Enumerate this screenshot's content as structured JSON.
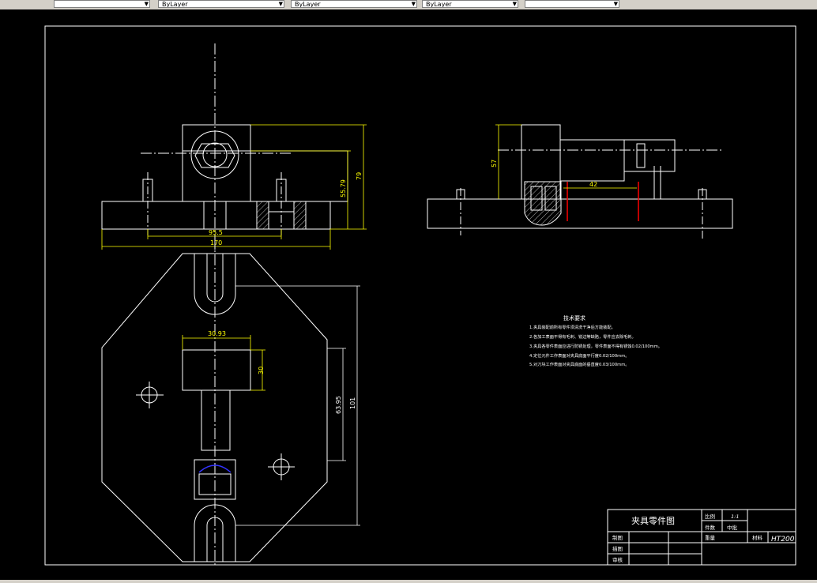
{
  "toolbar": {
    "layer_value": "",
    "color_value": "ByLayer",
    "linetype_value": "ByLayer",
    "lineweight_value": "ByLayer",
    "plotstyle_value": ""
  },
  "dims": {
    "d170": "170",
    "d95_5": "95.5",
    "d79": "79",
    "d55_79": "55.79",
    "d57": "57",
    "d42": "42",
    "d30_93": "30.93",
    "d30": "30",
    "d63_95": "63.95",
    "d101": "101"
  },
  "tech": {
    "title": "技术要求",
    "lines": [
      "1.夹具装配前所有零件须清洗干净后方能装配。",
      "2.各加工表面不得有毛刺、锐边等缺陷，零件应去除毛刺。",
      "3.夹具各零件表面应进行防锈处理，零件表面不得有锈蚀0.02/100mm。",
      "4.定位元件工作表面对夹具底面平行度0.02/100mm。",
      "5.对刀块工作表面对夹具底面的垂直度0.03/100mm。"
    ]
  },
  "title_block": {
    "name": "夹具零件图",
    "scale_label": "比例",
    "scale_value": "1:1",
    "count_label": "件数",
    "count_value": "中批",
    "weight_label": "重量",
    "material_label": "材料",
    "material_value": "HT200",
    "drawn_label": "制图",
    "designed_label": "描图",
    "checked_label": "审核"
  },
  "colors": {
    "lines": "#ffffff",
    "dimension": "#ffff00",
    "accent_red": "#ff0000",
    "accent_blue": "#3333ff"
  }
}
